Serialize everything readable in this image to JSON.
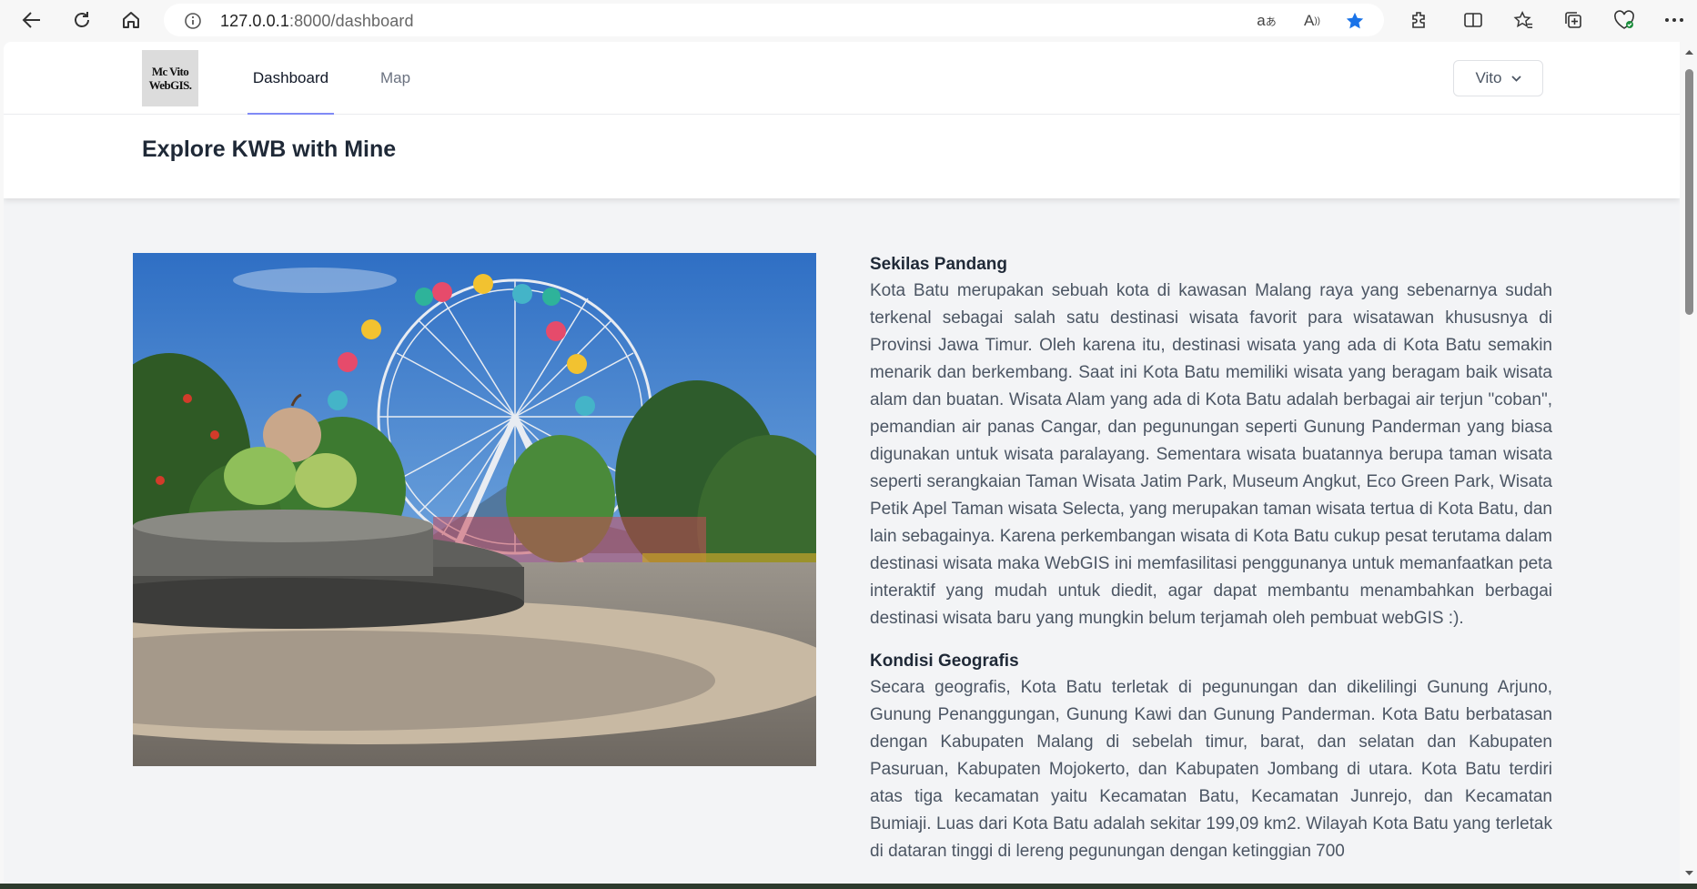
{
  "browser": {
    "url_host": "127.0.0.1",
    "url_path": ":8000/dashboard",
    "icons": [
      "back-icon",
      "refresh-icon",
      "home-icon",
      "info-icon",
      "translate-icon",
      "read-aloud-icon",
      "favorite-star-icon",
      "extensions-icon",
      "split-screen-icon",
      "favorites-icon",
      "collections-icon",
      "browser-essentials-icon",
      "more-icon"
    ],
    "accent_color": "#1a73e8"
  },
  "topnav": {
    "logo_line1": "Mc Vito",
    "logo_line2": "WebGIS.",
    "links": [
      {
        "label": "Dashboard",
        "active": true
      },
      {
        "label": "Map",
        "active": false
      }
    ],
    "user_label": "Vito"
  },
  "header": {
    "title": "Explore KWB with Mine"
  },
  "main": {
    "image_subject": "ferris wheel and apple statue fountain park photo",
    "sections": [
      {
        "title": "Sekilas Pandang",
        "body": "Kota Batu merupakan sebuah kota di kawasan Malang raya yang sebenarnya sudah terkenal sebagai salah satu destinasi wisata favorit para wisatawan khususnya di Provinsi Jawa Timur. Oleh karena itu, destinasi wisata yang ada di Kota Batu semakin menarik dan berkembang. Saat ini Kota Batu memiliki wisata yang beragam baik wisata alam dan buatan. Wisata Alam yang ada di Kota Batu adalah berbagai air terjun \"coban\", pemandian air panas Cangar, dan pegunungan seperti Gunung Panderman yang biasa digunakan untuk wisata paralayang. Sementara wisata buatannya berupa taman wisata seperti serangkaian Taman Wisata Jatim Park, Museum Angkut, Eco Green Park, Wisata Petik Apel Taman wisata Selecta, yang merupakan taman wisata tertua di Kota Batu, dan lain sebagainya. Karena perkembangan wisata di Kota Batu cukup pesat terutama dalam destinasi wisata maka WebGIS ini memfasilitasi penggunanya untuk memanfaatkan peta interaktif yang mudah untuk diedit, agar dapat membantu menambahkan berbagai destinasi wisata baru yang mungkin belum terjamah oleh pembuat webGIS :)."
      },
      {
        "title": "Kondisi Geografis",
        "body": "Secara geografis, Kota Batu terletak di pegunungan dan dikelilingi Gunung Arjuno, Gunung Penanggungan, Gunung Kawi dan Gunung Panderman. Kota Batu berbatasan dengan Kabupaten Malang di sebelah timur, barat, dan selatan dan Kabupaten Pasuruan, Kabupaten Mojokerto, dan Kabupaten Jombang di utara. Kota Batu terdiri atas tiga kecamatan yaitu Kecamatan Batu, Kecamatan Junrejo, dan Kecamatan Bumiaji. Luas dari Kota Batu adalah sekitar 199,09 km2. Wilayah Kota Batu yang terletak di dataran tinggi di lereng pegunungan dengan ketinggian 700"
      }
    ]
  },
  "colors": {
    "page_bg": "#f3f4f6",
    "nav_active_underline": "#818cf8",
    "heading": "#1f2937",
    "body_text": "#4b5563"
  }
}
